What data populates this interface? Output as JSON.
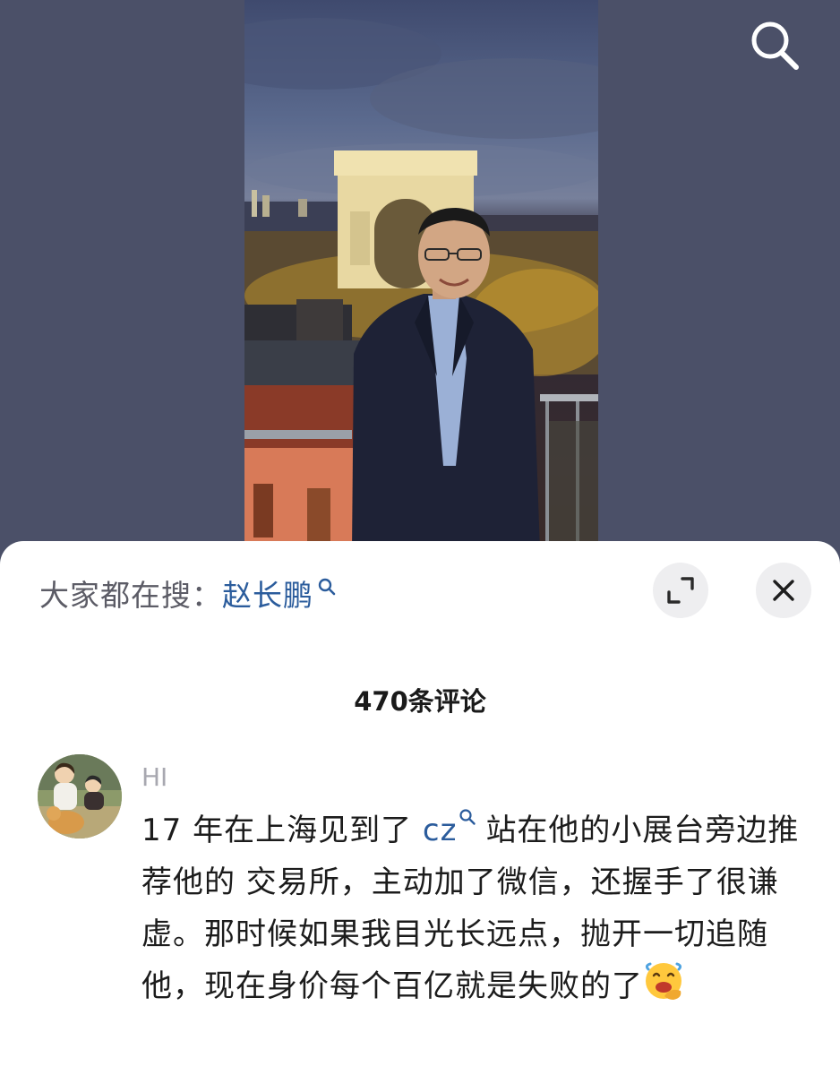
{
  "search": {
    "icon": "search-icon"
  },
  "trending": {
    "label": "大家都在搜：",
    "term": "赵长鹏",
    "term_color": "#2b5c9c"
  },
  "sheet_controls": {
    "expand_icon": "expand-icon",
    "close_icon": "close-icon"
  },
  "comments": {
    "count_label": "470条评论",
    "items": [
      {
        "username": "HI",
        "text_before": "17 年在上海见到了 ",
        "link": "cz",
        "text_after": "站在他的小展台旁边推荐他的 交易所，主动加了微信，还握手了很谦虚。那时候如果我目光长远点，抛开一切追随他，现在身价每个百亿就是失败的了",
        "emoji": "face-with-hand-over-mouth-emoji"
      }
    ]
  }
}
